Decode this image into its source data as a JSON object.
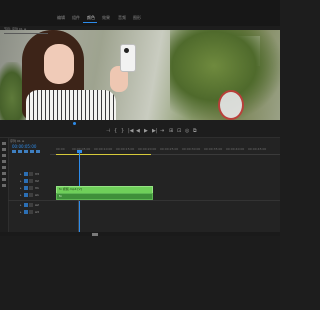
{
  "menu": {
    "items": [
      "编辑",
      "组件",
      "颜色",
      "效果",
      "音频",
      "图形"
    ],
    "active_index": 2
  },
  "monitor": {
    "tab_label": "节目: 序列 01 ≡",
    "accent_color": "#2d8ceb"
  },
  "transport": {
    "buttons": [
      "⊣",
      "{",
      "}",
      "|◀",
      "◀",
      "▶",
      "▶|",
      "⇥",
      "⊞",
      "⊡",
      "◎",
      "⧉"
    ]
  },
  "timeline": {
    "sequence_tab": "序列 01 ≡",
    "timecode": "00:00:05:00",
    "ruler_labels": [
      "00:00",
      "00:00:05:00",
      "00:00:10:00",
      "00:00:15:00",
      "00:00:20:00",
      "00:00:25:00",
      "00:00:30:00",
      "00:00:35:00",
      "00:00:40:00",
      "00:00:45:00"
    ],
    "tracks": [
      {
        "name": "V3",
        "type": "video"
      },
      {
        "name": "V2",
        "type": "video"
      },
      {
        "name": "V1",
        "type": "video"
      },
      {
        "name": "A1",
        "type": "audio"
      },
      {
        "name": "A2",
        "type": "audio"
      },
      {
        "name": "A3",
        "type": "audio"
      }
    ],
    "clips": {
      "video": "fx 视频.mp4 [V]",
      "audio": "fx"
    },
    "clip_color": "#6fcf5a"
  }
}
